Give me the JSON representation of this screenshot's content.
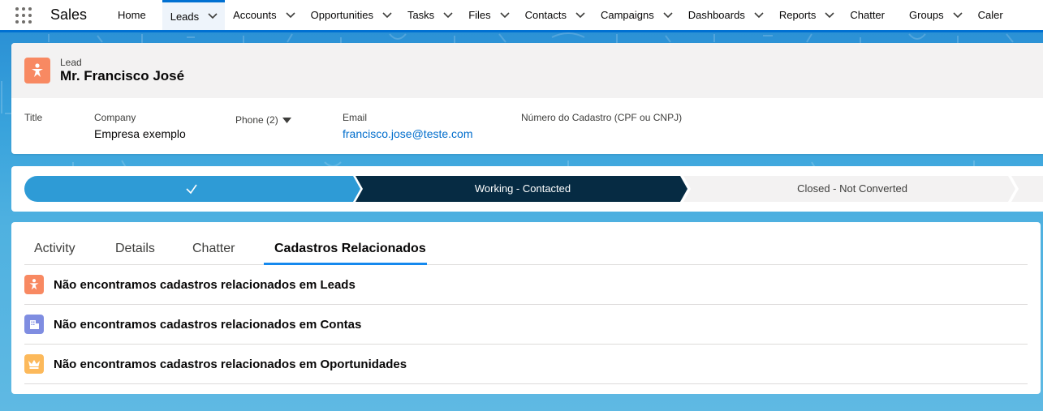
{
  "app": {
    "name": "Sales"
  },
  "nav": {
    "items": [
      {
        "label": "Home",
        "has_menu": false
      },
      {
        "label": "Leads",
        "has_menu": true,
        "active": true
      },
      {
        "label": "Accounts",
        "has_menu": true
      },
      {
        "label": "Opportunities",
        "has_menu": true
      },
      {
        "label": "Tasks",
        "has_menu": true
      },
      {
        "label": "Files",
        "has_menu": true
      },
      {
        "label": "Contacts",
        "has_menu": true
      },
      {
        "label": "Campaigns",
        "has_menu": true
      },
      {
        "label": "Dashboards",
        "has_menu": true
      },
      {
        "label": "Reports",
        "has_menu": true
      },
      {
        "label": "Chatter",
        "has_menu": false
      },
      {
        "label": "Groups",
        "has_menu": true
      },
      {
        "label": "Caler",
        "has_menu": false
      }
    ]
  },
  "record": {
    "object_label": "Lead",
    "name": "Mr. Francisco José",
    "icon": "lead-person-icon",
    "icon_color": "#f88962",
    "fields": {
      "title": {
        "label": "Title",
        "value": ""
      },
      "company": {
        "label": "Company",
        "value": "Empresa exemplo"
      },
      "phone": {
        "label": "Phone (2)"
      },
      "email": {
        "label": "Email",
        "value": "francisco.jose@teste.com"
      },
      "cadastro": {
        "label": "Número do Cadastro (CPF ou CNPJ)",
        "value": ""
      }
    }
  },
  "path": {
    "steps": [
      {
        "label": "",
        "status": "complete"
      },
      {
        "label": "Working - Contacted",
        "status": "current"
      },
      {
        "label": "Closed - Not Converted",
        "status": "incomplete"
      }
    ],
    "colors": {
      "complete": "#2e9bd6",
      "current": "#062b43",
      "incomplete": "#f3f2f2"
    }
  },
  "tabs": {
    "items": [
      "Activity",
      "Details",
      "Chatter",
      "Cadastros Relacionados"
    ],
    "active": "Cadastros Relacionados"
  },
  "related": [
    {
      "text": "Não encontramos cadastros relacionados em Leads",
      "icon": "lead-icon",
      "color": "#f88962"
    },
    {
      "text": "Não encontramos cadastros relacionados em Contas",
      "icon": "account-icon",
      "color": "#7f8de1"
    },
    {
      "text": "Não encontramos cadastros relacionados em Oportunidades",
      "icon": "opportunity-icon",
      "color": "#fcb95b"
    }
  ]
}
